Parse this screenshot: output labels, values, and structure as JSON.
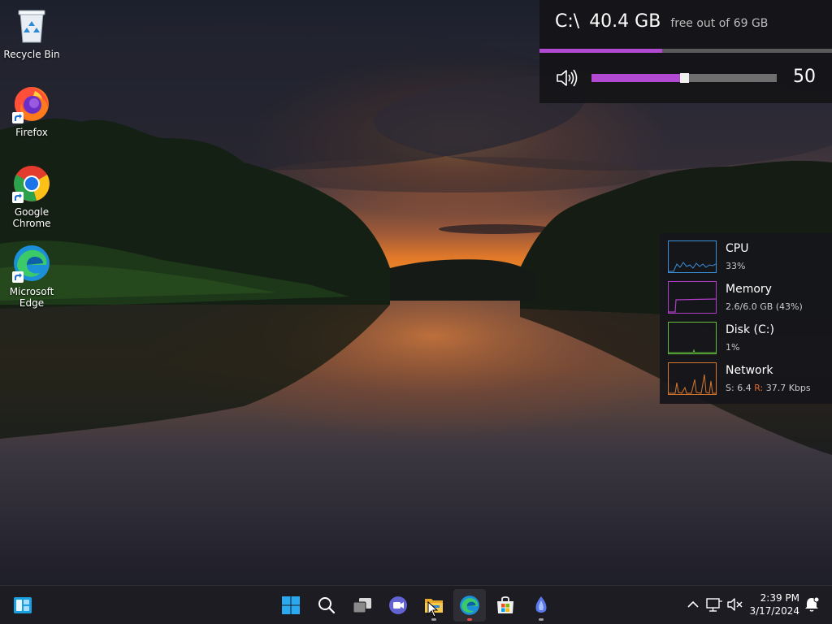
{
  "desktop": {
    "icons": [
      {
        "label": "Recycle Bin",
        "icon": "recycle-bin-icon"
      },
      {
        "label": "Firefox",
        "icon": "firefox-icon"
      },
      {
        "label": "Google\nChrome",
        "icon": "chrome-icon"
      },
      {
        "label": "Microsoft\nEdge",
        "icon": "edge-icon"
      }
    ]
  },
  "drive_widget": {
    "drive": "C:\\",
    "free": "40.4 GB",
    "total_text": "free out of 69 GB",
    "used_fraction": 0.42,
    "volume_value": "50",
    "volume_level": 0.5,
    "accent": "#b14ad0"
  },
  "performance": {
    "cpu": {
      "name": "CPU",
      "detail": "33%",
      "color": "#3b8fd6"
    },
    "memory": {
      "name": "Memory",
      "detail": "2.6/6.0 GB (43%)",
      "color": "#b03cc8"
    },
    "disk": {
      "name": "Disk (C:)",
      "detail": "1%",
      "color": "#5fbf3a"
    },
    "network": {
      "name": "Network",
      "send_label": "S:",
      "send_value": "6.4",
      "recv_label": "R:",
      "recv_value": "37.7 Kbps",
      "color": "#d4772f"
    }
  },
  "taskbar": {
    "apps": [
      "start-icon",
      "search-icon",
      "task-view-icon",
      "chat-icon",
      "file-explorer-icon",
      "edge-icon",
      "microsoft-store-icon",
      "app-icon"
    ],
    "clock": {
      "time": "2:39 PM",
      "date": "3/17/2024"
    }
  }
}
